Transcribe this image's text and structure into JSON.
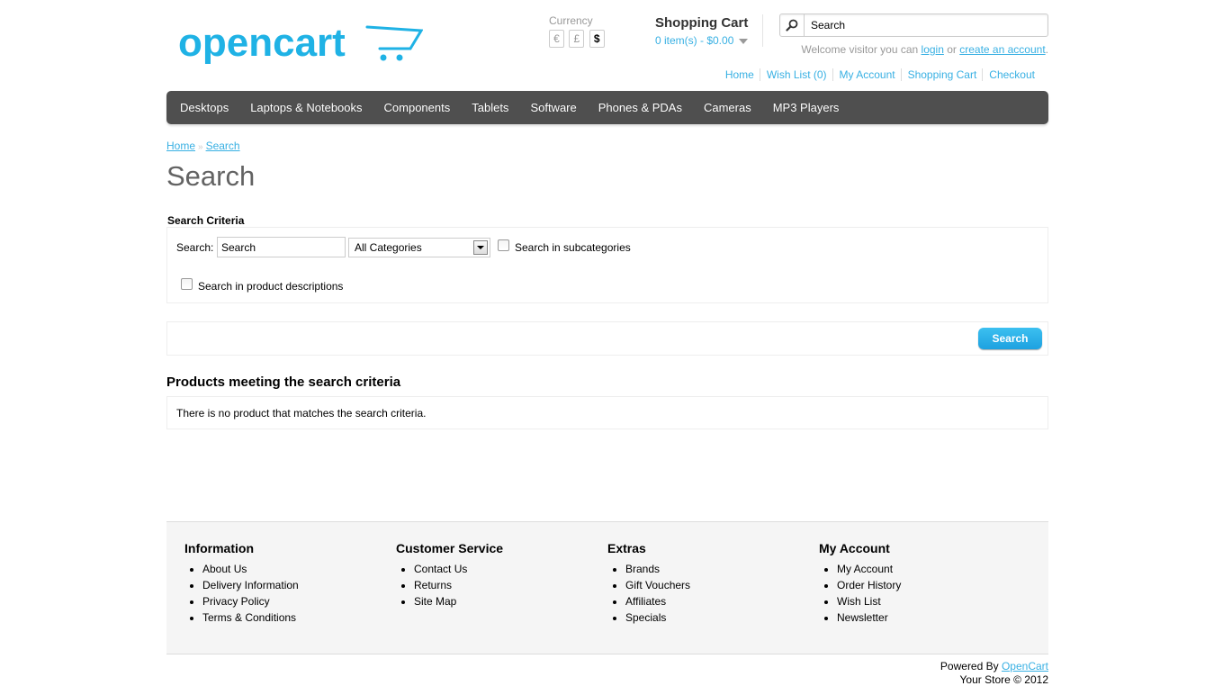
{
  "header": {
    "logo_text": "opencart",
    "currency": {
      "label": "Currency",
      "options": [
        "€",
        "£",
        "$"
      ],
      "selected": "$"
    },
    "cart": {
      "title": "Shopping Cart",
      "total": "0 item(s) - $0.00"
    },
    "search": {
      "value": "Search"
    },
    "welcome": {
      "prefix": "Welcome visitor you can",
      "login": "login",
      "or": "or",
      "create": "create an account",
      "suffix": "."
    },
    "links": [
      "Home",
      "Wish List (0)",
      "My Account",
      "Shopping Cart",
      "Checkout"
    ]
  },
  "menu": [
    "Desktops",
    "Laptops & Notebooks",
    "Components",
    "Tablets",
    "Software",
    "Phones & PDAs",
    "Cameras",
    "MP3 Players"
  ],
  "breadcrumb": {
    "home": "Home",
    "separator": "»",
    "current": "Search"
  },
  "page_title": "Search",
  "criteria": {
    "label": "Search Criteria",
    "search_label": "Search:",
    "search_value": "Search",
    "category_selected": "All Categories",
    "subcategories_label": "Search in subcategories",
    "descriptions_label": "Search in product descriptions",
    "submit_label": "Search"
  },
  "products": {
    "title": "Products meeting the search criteria",
    "empty_message": "There is no product that matches the search criteria."
  },
  "footer": {
    "columns": [
      {
        "title": "Information",
        "items": [
          "About Us",
          "Delivery Information",
          "Privacy Policy",
          "Terms & Conditions"
        ]
      },
      {
        "title": "Customer Service",
        "items": [
          "Contact Us",
          "Returns",
          "Site Map"
        ]
      },
      {
        "title": "Extras",
        "items": [
          "Brands",
          "Gift Vouchers",
          "Affiliates",
          "Specials"
        ]
      },
      {
        "title": "My Account",
        "items": [
          "My Account",
          "Order History",
          "Wish List",
          "Newsletter"
        ]
      }
    ],
    "powered_by": "Powered By",
    "powered_link": "OpenCart",
    "copyright": "Your Store © 2012"
  },
  "colors": {
    "accent": "#38b0e3",
    "menu_bg": "#4f4f4f",
    "button": "#1da1e0"
  }
}
